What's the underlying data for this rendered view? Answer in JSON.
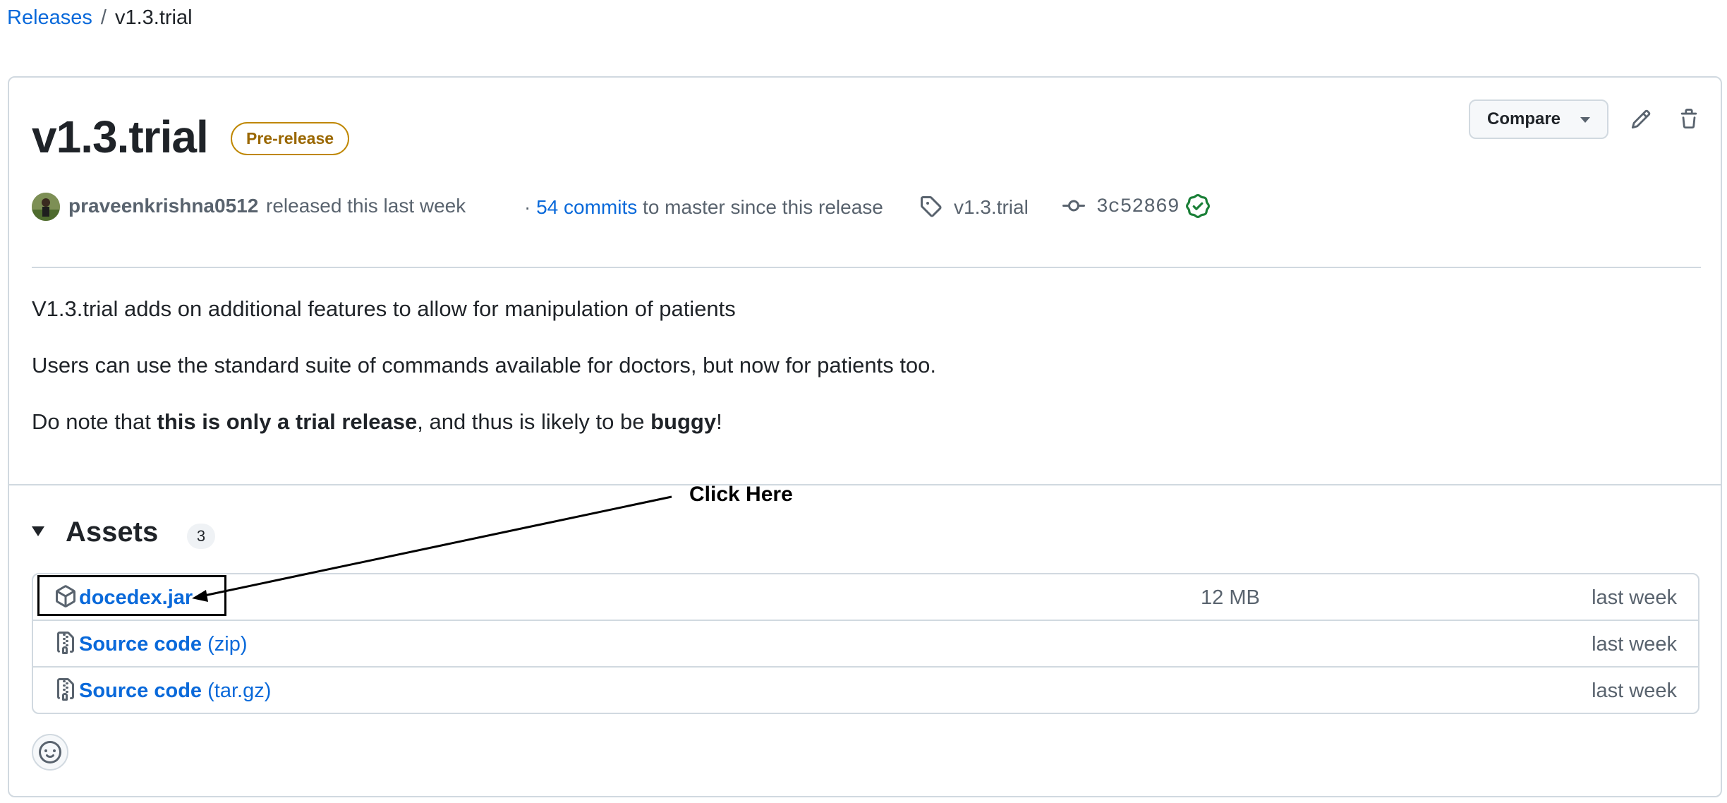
{
  "breadcrumb": {
    "releases_label": "Releases",
    "separator": "/",
    "current": "v1.3.trial"
  },
  "release": {
    "title": "v1.3.trial",
    "badge": "Pre-release",
    "compare_label": "Compare",
    "author": "praveenkrishna0512",
    "released_text": "released this last week",
    "commits_prefix": "·",
    "commits_link": "54 commits",
    "commits_suffix": "to master since this release",
    "tag": "v1.3.trial",
    "commit_sha": "3c52869"
  },
  "notes": {
    "p1": "V1.3.trial adds on additional features to allow for manipulation of patients",
    "p2": "Users can use the standard suite of commands available for doctors, but now for patients too.",
    "p3_a": "Do note that ",
    "p3_bold1": "this is only a trial release",
    "p3_b": ", and thus is likely to be ",
    "p3_bold2": "buggy",
    "p3_c": "!"
  },
  "assets": {
    "title": "Assets",
    "count": "3",
    "items": [
      {
        "name": "docedex.jar",
        "ext": "",
        "size": "12 MB",
        "date": "last week",
        "icon": "package-icon"
      },
      {
        "name": "Source code",
        "ext": "(zip)",
        "size": "",
        "date": "last week",
        "icon": "file-zip-icon"
      },
      {
        "name": "Source code",
        "ext": "(tar.gz)",
        "size": "",
        "date": "last week",
        "icon": "file-zip-icon"
      }
    ]
  },
  "annotation": {
    "text": "Click Here"
  },
  "colors": {
    "link": "#0969da",
    "badge_border": "#bf8700",
    "badge_text": "#9a6700",
    "verified": "#1a7f37"
  }
}
